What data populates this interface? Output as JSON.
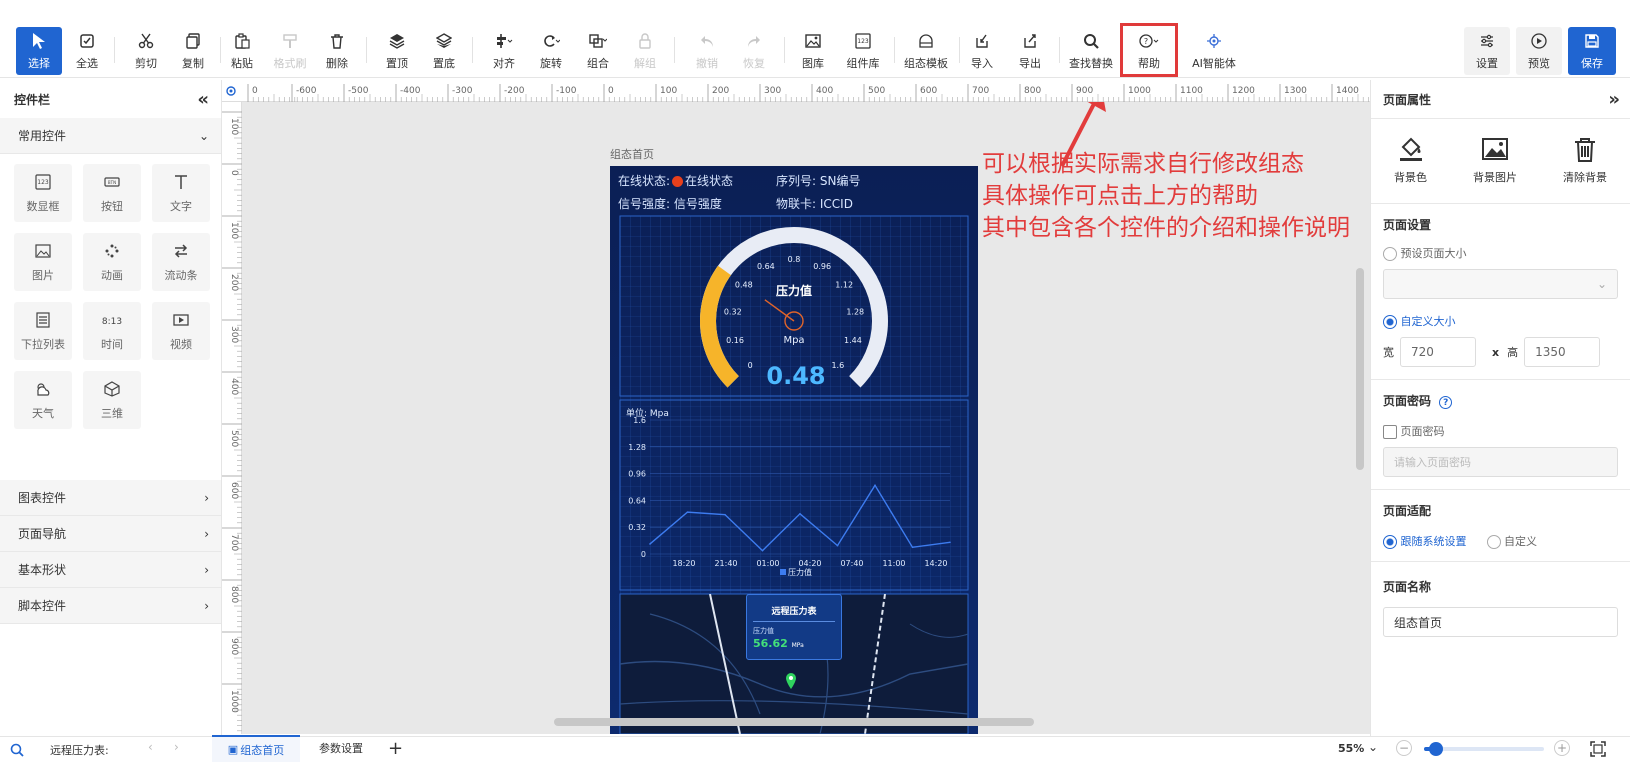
{
  "toolbar": {
    "select": "选择",
    "select_all": "全选",
    "cut": "剪切",
    "copy": "复制",
    "paste": "粘贴",
    "format_brush": "格式刷",
    "delete": "删除",
    "top": "置顶",
    "bottom": "置底",
    "align": "对齐",
    "rotate": "旋转",
    "group": "组合",
    "ungroup": "解组",
    "undo": "撤销",
    "redo": "恢复",
    "gallery": "图库",
    "component_lib": "组件库",
    "template": "组态模板",
    "import": "导入",
    "export": "导出",
    "find_replace": "查找替换",
    "help": "帮助",
    "ai": "AI智能体",
    "settings": "设置",
    "preview": "预览",
    "save": "保存"
  },
  "left_panel": {
    "title": "控件栏",
    "section_common": "常用控件",
    "widgets": [
      {
        "label": "数显框",
        "icon": "numeric-display-icon"
      },
      {
        "label": "按钮",
        "icon": "button-icon"
      },
      {
        "label": "文字",
        "icon": "text-icon"
      },
      {
        "label": "图片",
        "icon": "image-icon"
      },
      {
        "label": "动画",
        "icon": "animation-icon"
      },
      {
        "label": "流动条",
        "icon": "flow-bar-icon"
      },
      {
        "label": "下拉列表",
        "icon": "dropdown-list-icon"
      },
      {
        "label": "时间",
        "icon": "time-icon"
      },
      {
        "label": "视频",
        "icon": "video-icon"
      },
      {
        "label": "天气",
        "icon": "weather-icon"
      },
      {
        "label": "三维",
        "icon": "3d-cube-icon"
      }
    ],
    "sections": [
      "图表控件",
      "页面导航",
      "基本形状",
      "脚本控件"
    ]
  },
  "ruler": {
    "h_ticks": [
      "0",
      "-600",
      "-500",
      "-400",
      "-300",
      "-200",
      "-100",
      "0",
      "100",
      "200",
      "300",
      "400",
      "500",
      "600",
      "700",
      "800",
      "900",
      "1000",
      "1100",
      "1200",
      "1300",
      "1400"
    ],
    "v_ticks": [
      "100",
      "0",
      "100",
      "200",
      "300",
      "400",
      "500",
      "600",
      "700",
      "800",
      "900",
      "1000"
    ]
  },
  "page": {
    "name_label": "组态首页",
    "online_label": "在线状态:",
    "online_value": "在线状态",
    "sn_label": "序列号:",
    "sn_value": "SN编号",
    "signal_label": "信号强度:",
    "signal_value": "信号强度",
    "iot_label": "物联卡:",
    "iot_value": "ICCID",
    "gauge": {
      "title": "压力值",
      "unit": "Mpa",
      "value": 0.48,
      "value_text": "0.48",
      "min": 0,
      "max": 1.6,
      "tick_labels": [
        "0",
        "0.16",
        "0.32",
        "0.48",
        "0.64",
        "0.8",
        "0.96",
        "1.12",
        "1.28",
        "1.44",
        "1.6"
      ]
    },
    "chart_unit": "单位: Mpa",
    "map_popup_title": "远程压力表",
    "map_popup_label": "压力值",
    "map_popup_value": "56.62",
    "map_popup_unit": "MPa"
  },
  "chart_data": {
    "type": "line",
    "title": "",
    "xlabel": "",
    "ylabel": "单位: Mpa",
    "x": [
      "18:20",
      "21:40",
      "01:00",
      "04:20",
      "07:40",
      "11:00",
      "14:20"
    ],
    "y_ticks": [
      "0",
      "0.32",
      "0.64",
      "0.96",
      "1.28",
      "1.6"
    ],
    "ylim": [
      0,
      1.6
    ],
    "series": [
      {
        "name": "压力值",
        "color": "#3d7cf0",
        "values": [
          0.12,
          0.5,
          0.47,
          0.04,
          0.48,
          0.1,
          0.82,
          0.08,
          0.14
        ]
      }
    ],
    "legend": "bottom",
    "grid": true
  },
  "annotation": [
    "可以根据实际需求自行修改组态",
    "具体操作可点击上方的帮助",
    "其中包含各个控件的介绍和操作说明"
  ],
  "right_panel": {
    "title": "页面属性",
    "bg_color": "背景色",
    "bg_image": "背景图片",
    "clear_bg": "清除背景",
    "page_settings": "页面设置",
    "preset_size": "预设页面大小",
    "custom_size": "自定义大小",
    "width_label": "宽",
    "width_value": "720",
    "x_label": "x",
    "height_label": "高",
    "height_value": "1350",
    "page_password": "页面密码",
    "page_password_check": "页面密码",
    "password_placeholder": "请输入页面密码",
    "page_fit": "页面适配",
    "follow_system": "跟随系统设置",
    "custom": "自定义",
    "page_name": "页面名称",
    "page_name_value": "组态首页"
  },
  "statusbar": {
    "project": "远程压力表:",
    "tab_home": "组态首页",
    "tab_params": "参数设置",
    "zoom": "55%",
    "zoom_level": 0.1
  },
  "colors": {
    "accent": "#2065d1",
    "annotation": "#e23c3c",
    "gauge_fill": "#f6b42a",
    "gauge_track": "#e8ecf5",
    "dashboard_bg": "#0e2a6b"
  }
}
